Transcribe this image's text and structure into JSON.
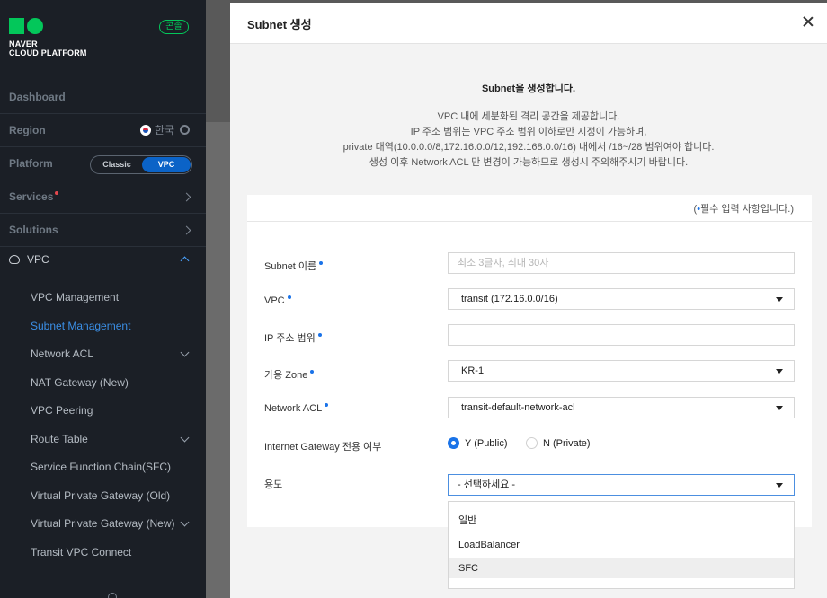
{
  "sidebar": {
    "logo_text_line1": "NAVER",
    "logo_text_line2": "CLOUD PLATFORM",
    "console_badge": "콘솔",
    "dashboard": "Dashboard",
    "region_label": "Region",
    "region_value": "한국",
    "platform_label": "Platform",
    "platform_classic": "Classic",
    "platform_vpc": "VPC",
    "services": "Services",
    "solutions": "Solutions",
    "vpc_header": "VPC",
    "vpc_items": [
      "VPC Management",
      "Subnet Management",
      "Network ACL",
      "NAT Gateway (New)",
      "VPC Peering",
      "Route Table",
      "Service Function Chain(SFC)",
      "Virtual Private Gateway (Old)",
      "Virtual Private Gateway (New)",
      "Transit VPC Connect"
    ],
    "active_item": "Subnet Management",
    "colors": {
      "brand_green": "#03c75a",
      "accent_blue": "#0b63c7"
    }
  },
  "modal": {
    "title": "Subnet 생성",
    "intro_title": "Subnet을 생성합니다.",
    "intro_lines": [
      "VPC 내에 세분화된 격리 공간을 제공합니다.",
      "IP 주소 범위는 VPC 주소 범위 이하로만 지정이 가능하며,",
      "private 대역(10.0.0.0/8,172.16.0.0/12,192.168.0.0/16) 내에서 /16~/28 범위여야 합니다.",
      "생성 이후 Network ACL 만 변경이 가능하므로 생성시 주의해주시기 바랍니다."
    ],
    "required_note_open": "(",
    "required_note_dot": "•",
    "required_note_text": "필수 입력 사항입니다.)",
    "form": {
      "subnet_name_label": "Subnet 이름",
      "subnet_name_placeholder": "최소 3글자, 최대 30자",
      "vpc_label": "VPC",
      "vpc_value": "transit (172.16.0.0/16)",
      "ip_range_label": "IP 주소 범위",
      "ip_range_value": "",
      "zone_label": "가용 Zone",
      "zone_value": "KR-1",
      "acl_label": "Network ACL",
      "acl_value": "transit-default-network-acl",
      "igw_label": "Internet Gateway 전용 여부",
      "igw_yes": "Y (Public)",
      "igw_no": "N (Private)",
      "igw_selected": "Y (Public)",
      "usage_label": "용도",
      "usage_value": "- 선택하세요 -",
      "usage_options": [
        "일반",
        "LoadBalancer",
        "SFC"
      ],
      "usage_highlighted": "SFC"
    }
  }
}
